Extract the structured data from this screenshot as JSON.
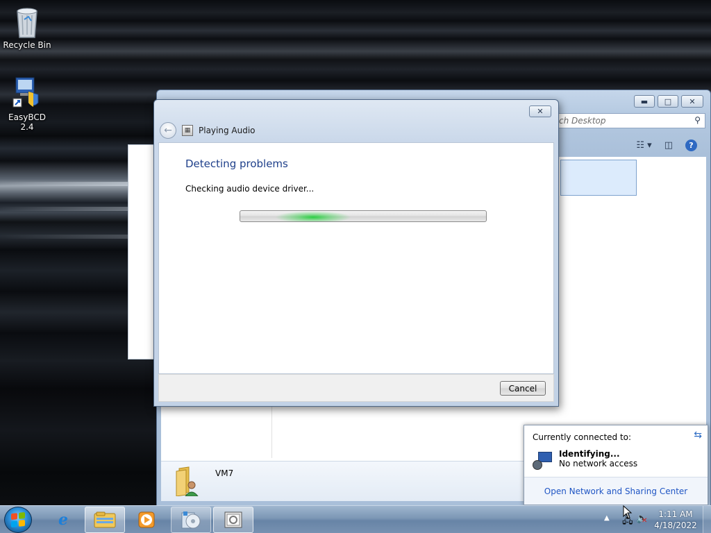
{
  "desktop": {
    "icons": [
      {
        "label": "Recycle Bin",
        "icon": "recycle-bin-icon"
      },
      {
        "label": "EasyBCD 2.4",
        "icon": "easybcd-icon"
      }
    ]
  },
  "background_window": {
    "search_placeholder": "ch Desktop",
    "details_item_name": "VM7"
  },
  "dialog": {
    "title": "Playing Audio",
    "heading": "Detecting problems",
    "status": "Checking audio device driver...",
    "progress_state": "indeterminate",
    "cancel_label": "Cancel",
    "colors": {
      "heading": "#1e3f8a",
      "progress_glow": "#22ce3c"
    }
  },
  "network_flyout": {
    "header": "Currently connected to:",
    "network_name": "Identifying...",
    "network_status": "No network access",
    "link": "Open Network and Sharing Center"
  },
  "taskbar": {
    "items": [
      {
        "icon": "internet-explorer-icon"
      },
      {
        "icon": "windows-explorer-icon",
        "state": "active"
      },
      {
        "icon": "media-player-icon"
      },
      {
        "icon": "disc-burner-icon",
        "state": "open"
      },
      {
        "icon": "troubleshooter-icon",
        "state": "active"
      }
    ],
    "clock": {
      "time": "1:11 AM",
      "date": "4/18/2022"
    }
  }
}
